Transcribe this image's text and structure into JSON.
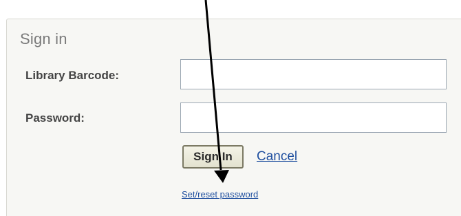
{
  "signin": {
    "title": "Sign in",
    "barcode_label": "Library Barcode:",
    "barcode_value": "",
    "password_label": "Password:",
    "password_value": "",
    "signin_button": "Sign In",
    "cancel_link": "Cancel",
    "reset_link": "Set/reset password"
  },
  "colors": {
    "panel_background": "#f7f7f4",
    "link": "#1f4f9f",
    "button_border": "#7c7a64",
    "arrow": "#000000"
  },
  "annotation": {
    "arrow_icon": "arrow-down-icon"
  }
}
